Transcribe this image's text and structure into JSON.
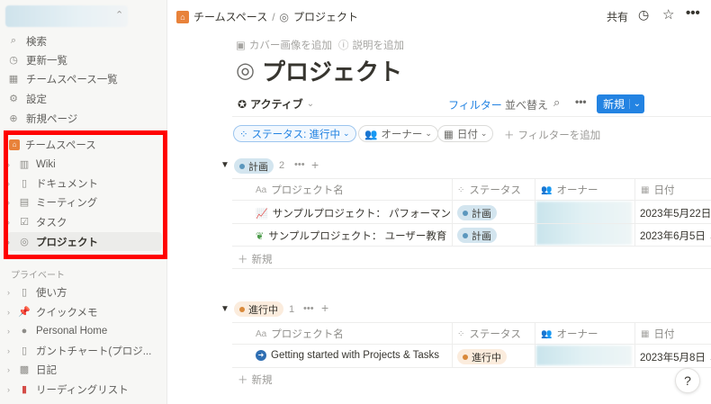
{
  "sidebar": {
    "top_items": [
      {
        "icon": "search-icon",
        "label": "検索"
      },
      {
        "icon": "clock-icon",
        "label": "更新一覧"
      },
      {
        "icon": "building-icon",
        "label": "チームスペース一覧"
      },
      {
        "icon": "gear-icon",
        "label": "設定"
      },
      {
        "icon": "plus-circle-icon",
        "label": "新規ページ"
      }
    ],
    "teamspace_label": "チームスペース",
    "teamspace_items": [
      {
        "icon": "book-icon",
        "label": "Wiki"
      },
      {
        "icon": "document-icon",
        "label": "ドキュメント"
      },
      {
        "icon": "meeting-icon",
        "label": "ミーティング"
      },
      {
        "icon": "checkbox-icon",
        "label": "タスク"
      },
      {
        "icon": "target-icon",
        "label": "プロジェクト"
      }
    ],
    "private_label": "プライベート",
    "private_items": [
      {
        "icon": "document-icon",
        "label": "使い方"
      },
      {
        "icon": "pin-icon",
        "label": "クイックメモ"
      },
      {
        "icon": "person-icon",
        "label": "Personal Home"
      },
      {
        "icon": "document-icon",
        "label": "ガントチャート(プロジ..."
      },
      {
        "icon": "notebook-icon",
        "label": "日記"
      },
      {
        "icon": "red-book-icon",
        "label": "リーディングリスト"
      }
    ]
  },
  "topbar": {
    "breadcrumb_1": "チームスペース",
    "separator": "/",
    "breadcrumb_2": "プロジェクト",
    "share_label": "共有"
  },
  "page": {
    "add_cover": "カバー画像を追加",
    "add_description": "説明を追加",
    "title": "プロジェクト"
  },
  "view": {
    "active_view": "アクティブ",
    "filter": "フィルター",
    "sort": "並べ替え",
    "new_button": "新規",
    "status_filter": "ステータス: 進行中",
    "owner_filter": "オーナー",
    "date_filter": "日付",
    "add_filter": "フィルターを追加"
  },
  "columns": {
    "name": "プロジェクト名",
    "status": "ステータス",
    "owner": "オーナー",
    "date": "日付"
  },
  "groups": [
    {
      "label": "計画",
      "count": "2",
      "rows": [
        {
          "icon": "chart-icon",
          "name": "サンプルプロジェクト： パフォーマンス",
          "status": "計画",
          "date": "2023年5月22日"
        },
        {
          "icon": "plant-icon",
          "name": "サンプルプロジェクト： ユーザー教育",
          "status": "計画",
          "date": "2023年6月5日 →"
        }
      ],
      "new_label": "新規"
    },
    {
      "label": "進行中",
      "count": "1",
      "rows": [
        {
          "icon": "arrow-circle-icon",
          "name": "Getting started with Projects & Tasks",
          "status": "進行中",
          "date": "2023年5月8日 →"
        }
      ],
      "new_label": "新規"
    }
  ],
  "help_label": "?",
  "colors": {
    "accent": "#2383e2",
    "highlight_box": "#ff0000",
    "status_plan": "#d3e5ef",
    "status_progress": "#fbecdd"
  }
}
